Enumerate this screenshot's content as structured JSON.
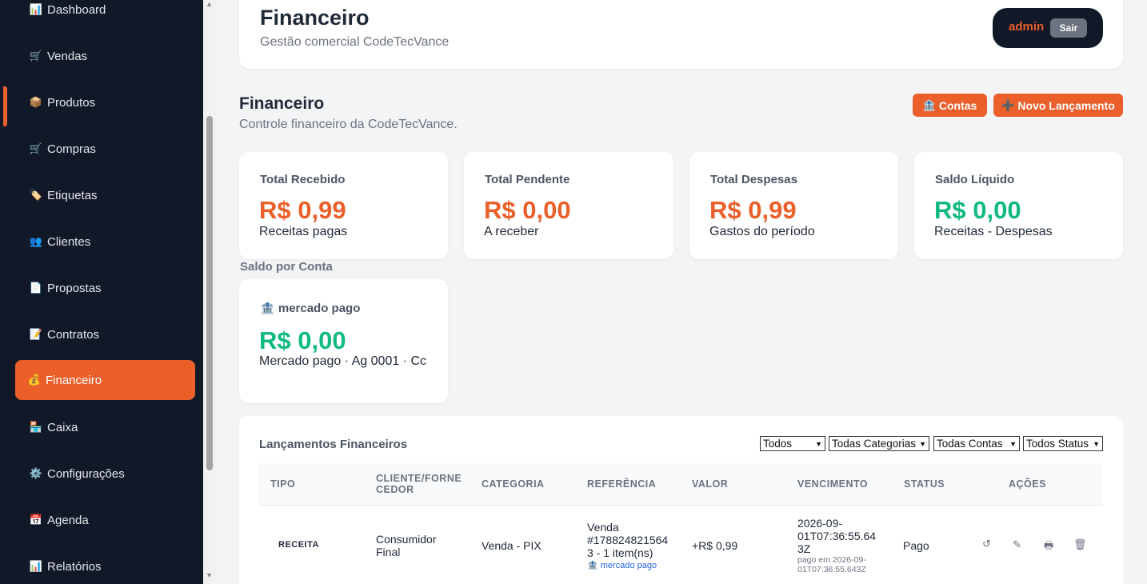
{
  "sidebar": {
    "items": [
      {
        "icon": "📊",
        "label": "Dashboard"
      },
      {
        "icon": "🛒",
        "label": "Vendas"
      },
      {
        "icon": "📦",
        "label": "Produtos"
      },
      {
        "icon": "🛒",
        "label": "Compras"
      },
      {
        "icon": "🏷️",
        "label": "Etiquetas"
      },
      {
        "icon": "👥",
        "label": "Clientes"
      },
      {
        "icon": "📄",
        "label": "Propostas"
      },
      {
        "icon": "📝",
        "label": "Contratos"
      },
      {
        "icon": "💰",
        "label": "Financeiro"
      },
      {
        "icon": "🏪",
        "label": "Caixa"
      },
      {
        "icon": "⚙️",
        "label": "Configurações"
      },
      {
        "icon": "📅",
        "label": "Agenda"
      },
      {
        "icon": "📊",
        "label": "Relatórios"
      }
    ]
  },
  "header": {
    "title": "Financeiro",
    "subtitle": "Gestão comercial CodeTecVance",
    "user": "admin",
    "logout_label": "Sair"
  },
  "section": {
    "title": "Financeiro",
    "subtitle": "Controle financeiro da CodeTecVance.",
    "accounts_icon": "🏦",
    "accounts_label": "Contas",
    "new_icon": "➕",
    "new_label": "Novo Lançamento"
  },
  "summary": [
    {
      "label": "Total Recebido",
      "value": "R$ 0,99",
      "desc": "Receitas pagas"
    },
    {
      "label": "Total Pendente",
      "value": "R$ 0,00",
      "desc": "A receber"
    },
    {
      "label": "Total Despesas",
      "value": "R$ 0,99",
      "desc": "Gastos do período"
    },
    {
      "label": "Saldo Líquido",
      "value": "R$ 0,00",
      "desc": "Receitas - Despesas"
    }
  ],
  "saldo": {
    "label": "Saldo por Conta",
    "account": {
      "icon": "🏦",
      "name": "mercado pago",
      "value": "R$ 0,00",
      "desc": "Mercado pago · Ag 0001 · Cc"
    }
  },
  "table": {
    "title": "Lançamentos Financeiros",
    "filters": [
      "Todos",
      "Todas Categorias",
      "Todas Contas",
      "Todos Status"
    ],
    "headers": {
      "tipo": "TIPO",
      "cliente": "CLIENTE/FORNE\nCEDOR",
      "categoria": "CATEGORIA",
      "referencia": "REFERÊNCIA",
      "valor": "VALOR",
      "vencimento": "VENCIMENTO",
      "status": "STATUS",
      "acoes": "AÇÕES"
    },
    "rows": [
      {
        "tipo": "RECEITA",
        "cliente": "Consumidor\nFinal",
        "categoria": "Venda - PIX",
        "referencia": "Venda\n#178824821564\n3 - 1 item(ns)",
        "conta": "mercado pago",
        "valor": "+R$ 0,99",
        "vencimento": "2026-09-\n01T07:36:55.64\n3Z",
        "pago_em": "pago em 2026-09-\n01T07:36:55.643Z",
        "status": "Pago"
      }
    ]
  }
}
